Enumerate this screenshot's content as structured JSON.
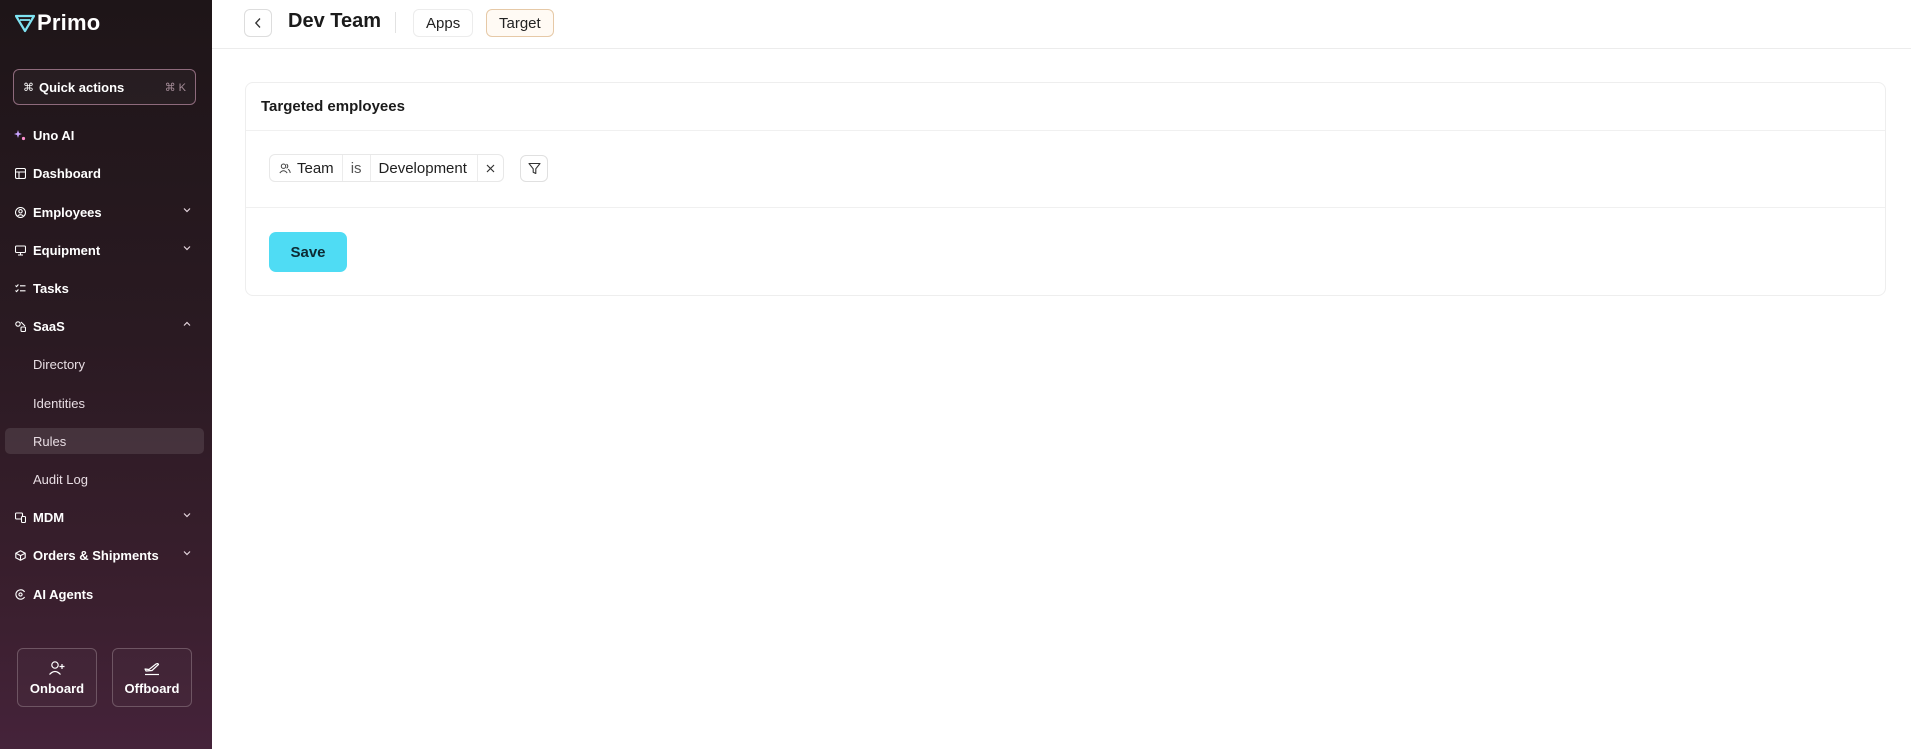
{
  "app": {
    "name": "Primo"
  },
  "quick_actions": {
    "label": "Quick actions",
    "shortcut": "⌘ K"
  },
  "sidebar": {
    "items": [
      {
        "label": "Uno AI"
      },
      {
        "label": "Dashboard"
      },
      {
        "label": "Employees"
      },
      {
        "label": "Equipment"
      },
      {
        "label": "Tasks"
      },
      {
        "label": "SaaS"
      },
      {
        "label": "MDM"
      },
      {
        "label": "Orders & Shipments"
      },
      {
        "label": "AI Agents"
      }
    ],
    "saas_sub": [
      {
        "label": "Directory"
      },
      {
        "label": "Identities"
      },
      {
        "label": "Rules",
        "active": true
      },
      {
        "label": "Audit Log"
      }
    ],
    "actions": {
      "onboard": "Onboard",
      "offboard": "Offboard"
    }
  },
  "header": {
    "title": "Dev Team",
    "tabs": [
      {
        "label": "Apps"
      },
      {
        "label": "Target",
        "active": true
      }
    ]
  },
  "card": {
    "title": "Targeted employees",
    "filter": {
      "field": "Team",
      "operator": "is",
      "value": "Development"
    },
    "save_label": "Save"
  },
  "colors": {
    "accent": "#4fdcf4",
    "sidebar_top": "#1e1518",
    "sidebar_bottom": "#45233a",
    "active_tab_border": "#e6c9a7"
  }
}
